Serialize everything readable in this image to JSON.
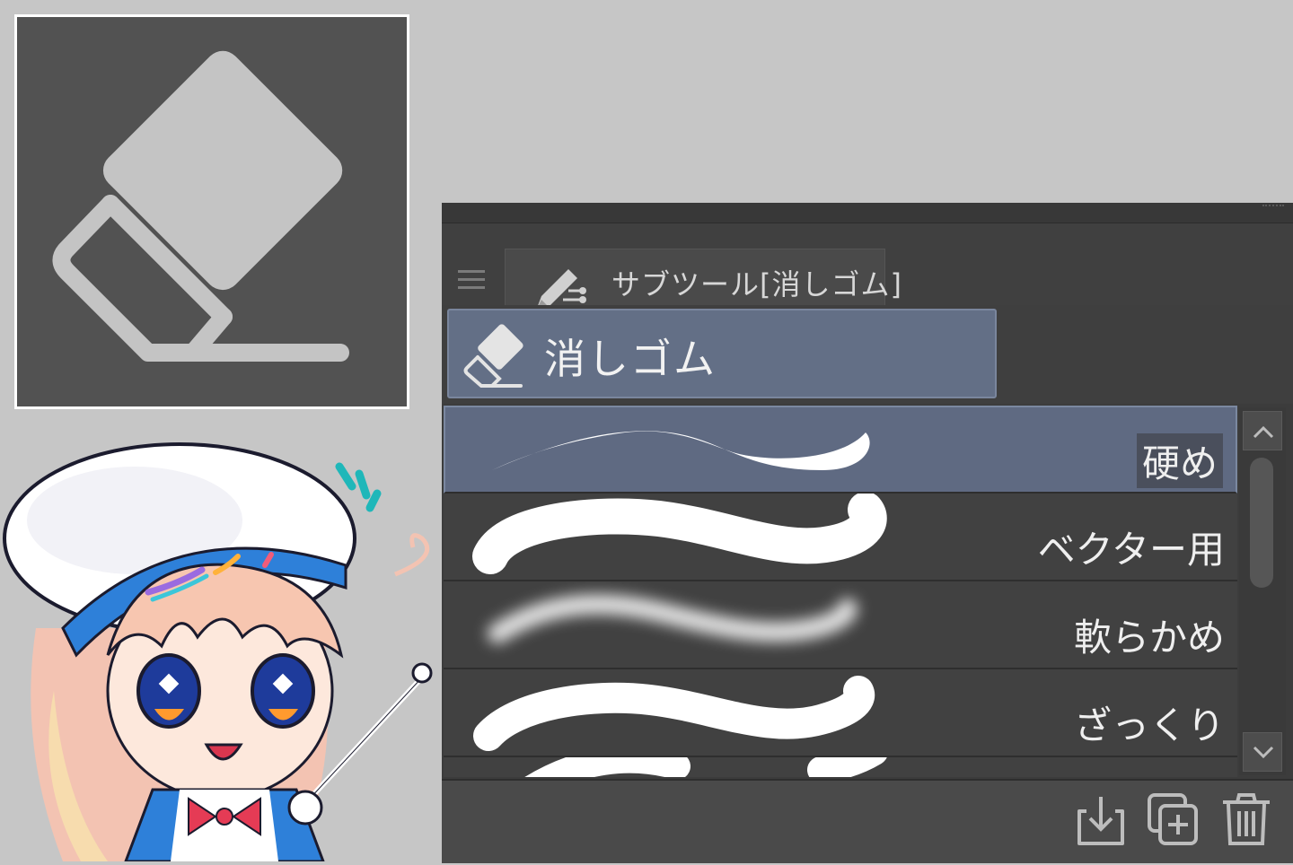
{
  "palette": {
    "tab_label": "サブツール[消しゴム]",
    "group_label": "消しゴム"
  },
  "subtools": [
    {
      "label": "硬め",
      "selected": true
    },
    {
      "label": "ベクター用",
      "selected": false
    },
    {
      "label": "軟らかめ",
      "selected": false
    },
    {
      "label": "ざっくり",
      "selected": false
    }
  ],
  "icons": {
    "hero": "eraser-icon",
    "menu": "menu-icon",
    "tab": "subtool-pen-icon",
    "group": "eraser-icon",
    "scroll_up": "chevron-up-icon",
    "scroll_down": "chevron-down-icon",
    "export": "download-icon",
    "duplicate": "duplicate-add-icon",
    "delete": "trash-icon"
  },
  "colors": {
    "background": "#c6c6c6",
    "icon_panel": "#525252",
    "palette": "#3c3c3c",
    "selection": "#636f86"
  }
}
